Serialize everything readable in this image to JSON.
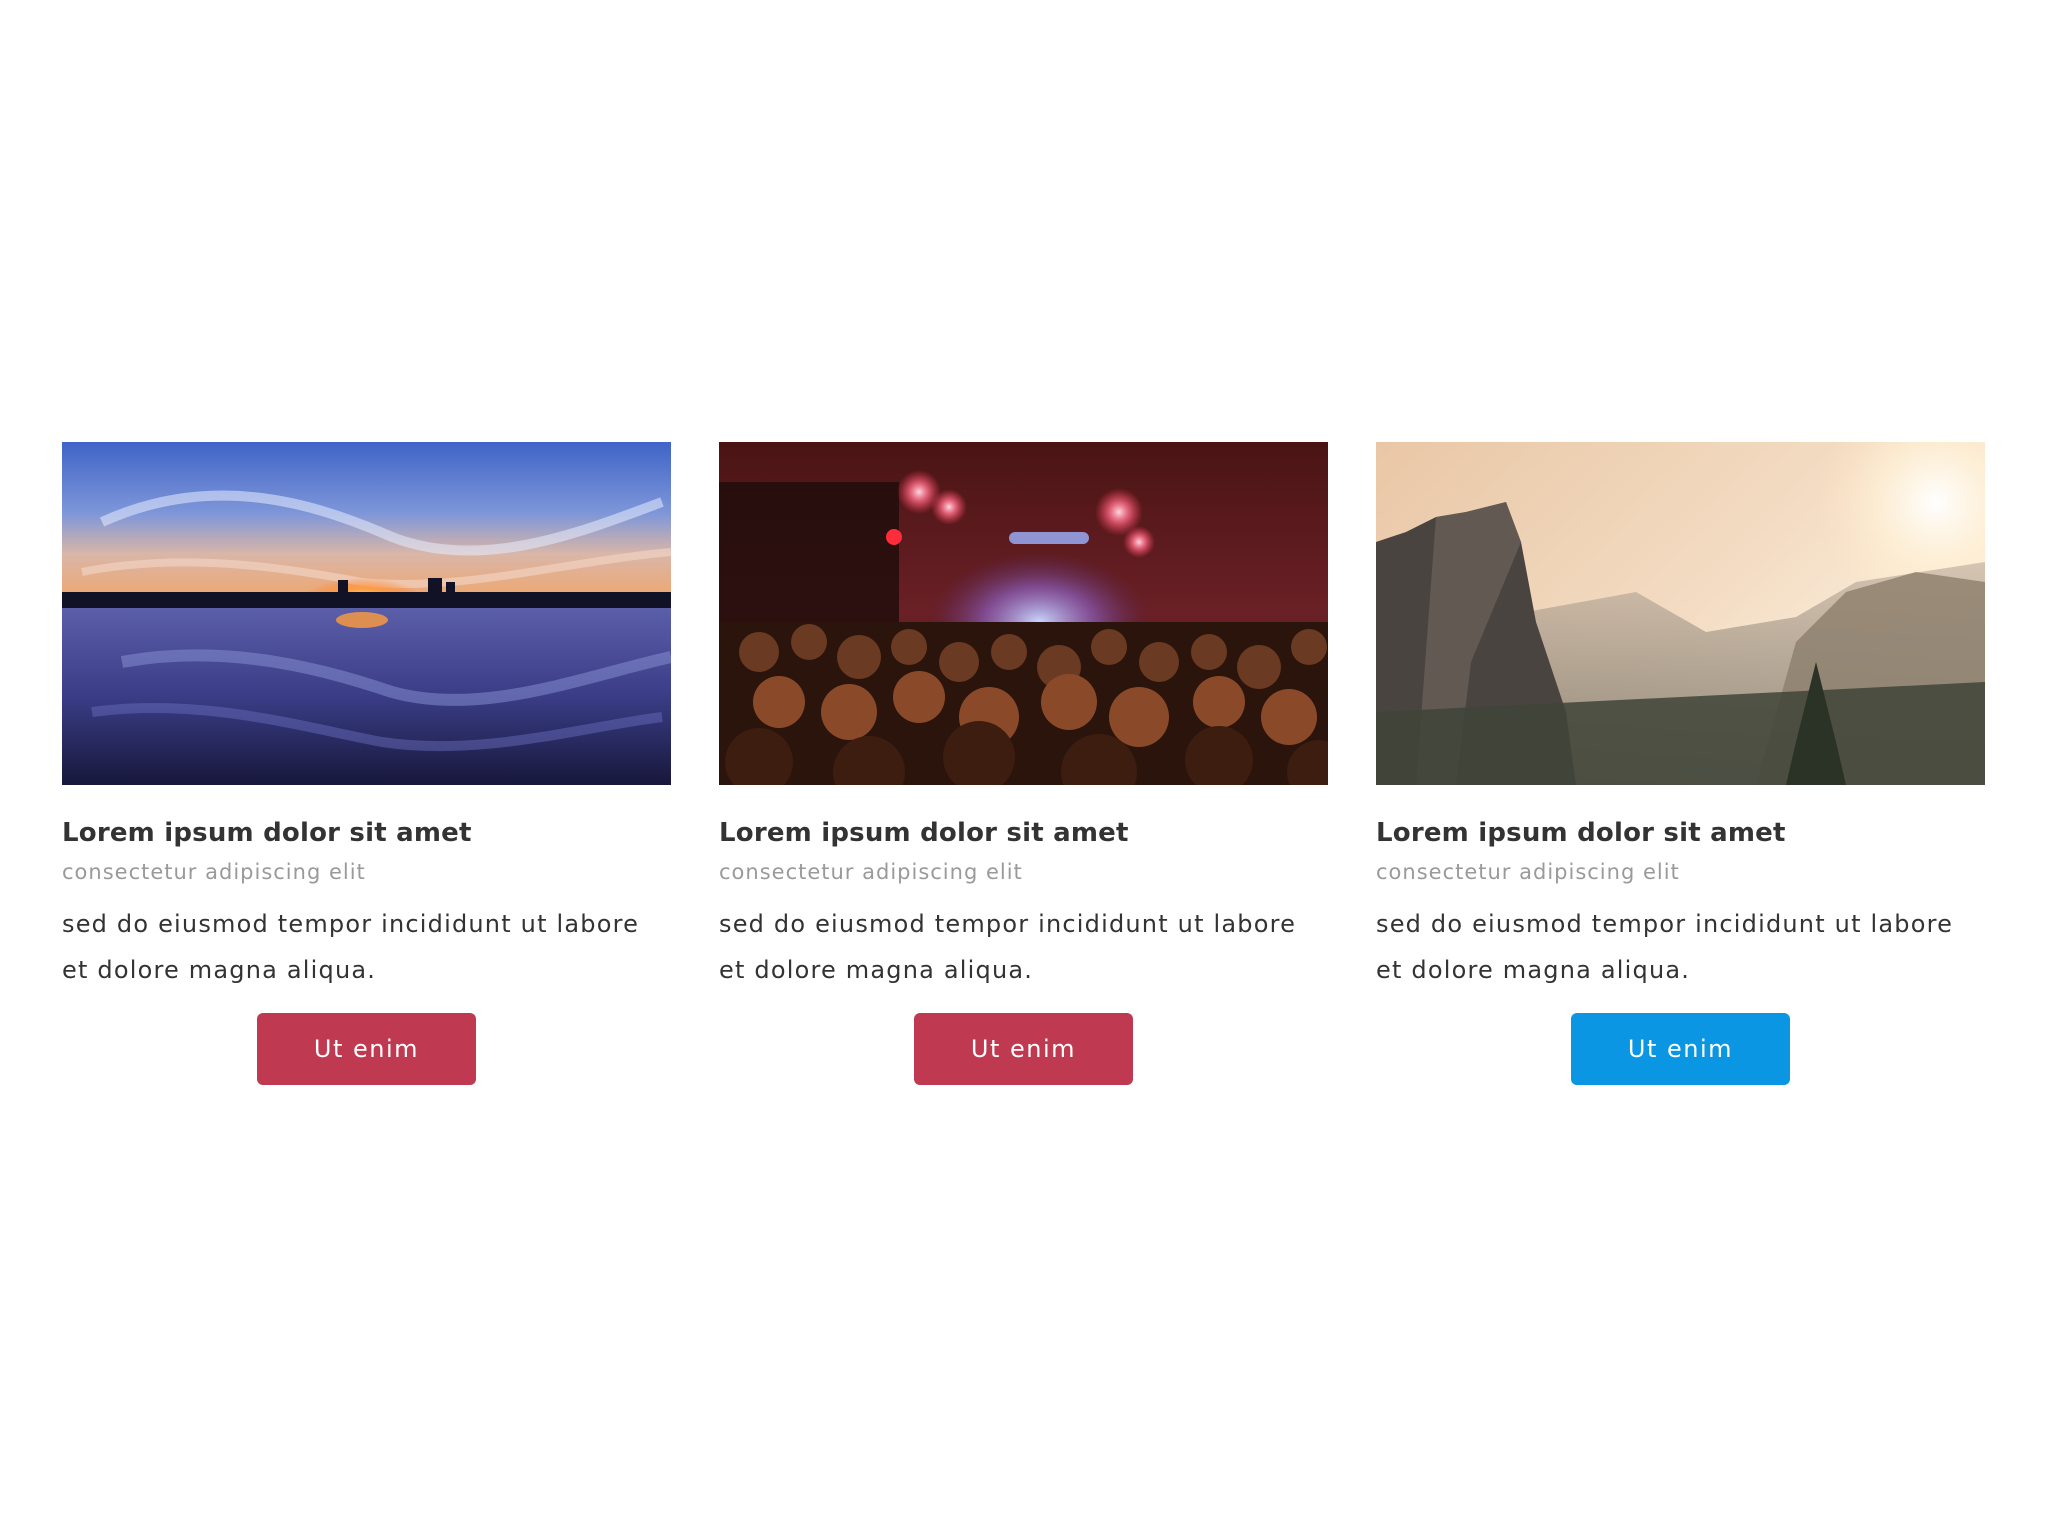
{
  "cards": [
    {
      "image_subject": "sunset over a lake with city skyline reflected in water",
      "title": "Lorem ipsum dolor sit amet",
      "subtitle": "consectetur adipiscing elit",
      "body": "sed do eiusmod tempor incididunt ut labore et dolore magna aliqua.",
      "button_label": "Ut enim",
      "button_color": "#bf3a51"
    },
    {
      "image_subject": "concert crowd with blurred red stage lights",
      "title": "Lorem ipsum dolor sit amet",
      "subtitle": "consectetur adipiscing elit",
      "body": "sed do eiusmod tempor incididunt ut labore et dolore magna aliqua.",
      "button_label": "Ut enim",
      "button_color": "#bf3a51"
    },
    {
      "image_subject": "mountain cliffs and valley with sunlight haze",
      "title": "Lorem ipsum dolor sit amet",
      "subtitle": "consectetur adipiscing elit",
      "body": "sed do eiusmod tempor incididunt ut labore et dolore magna aliqua.",
      "button_label": "Ut enim",
      "button_color": "#0a96e3"
    }
  ]
}
